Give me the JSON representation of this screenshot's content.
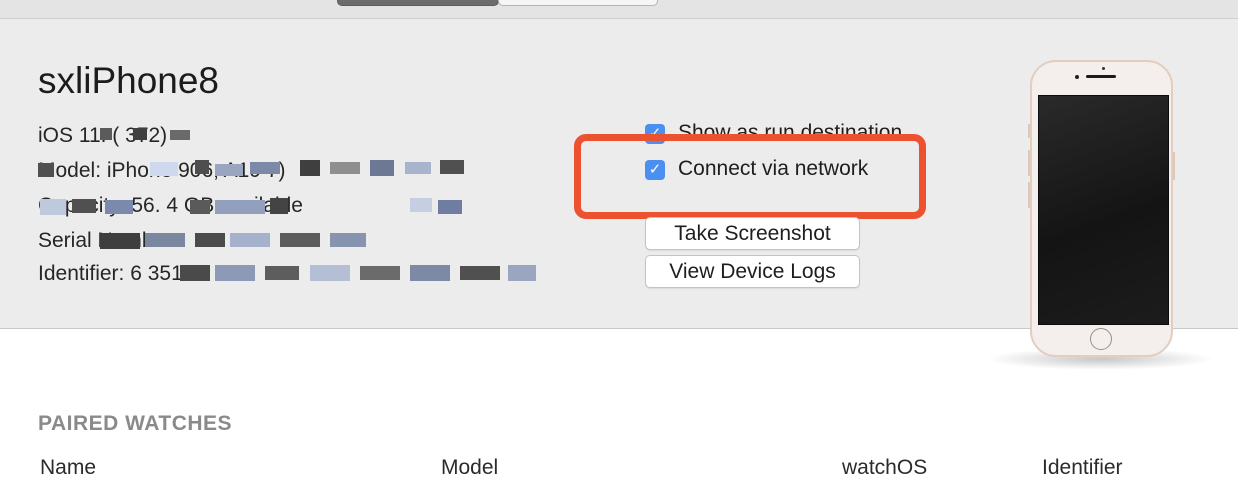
{
  "top_tabs": [
    "",
    ""
  ],
  "device": {
    "name": "sxliPhone8",
    "info_lines": [
      "iOS 11. (    372)",
      "Model: iPhone                                 906, A19 7)",
      "Capacity: 56.          4 GB available",
      "Serial Number",
      "Identifier: 6                                        351c4"
    ],
    "checkboxes": [
      {
        "label": "Show as run destination",
        "checked": true
      },
      {
        "label": "Connect via network",
        "checked": true
      }
    ],
    "buttons": {
      "screenshot": "Take Screenshot",
      "logs": "View Device Logs"
    },
    "check_glyph": "✓"
  },
  "annotation": {
    "highlight_color": "#ed5230"
  },
  "paired_watches": {
    "heading": "PAIRED WATCHES",
    "columns": [
      "Name",
      "Model",
      "watchOS",
      "Identifier"
    ]
  },
  "icons": [
    "checkbox-checked-icon",
    "iphone-device-image"
  ]
}
